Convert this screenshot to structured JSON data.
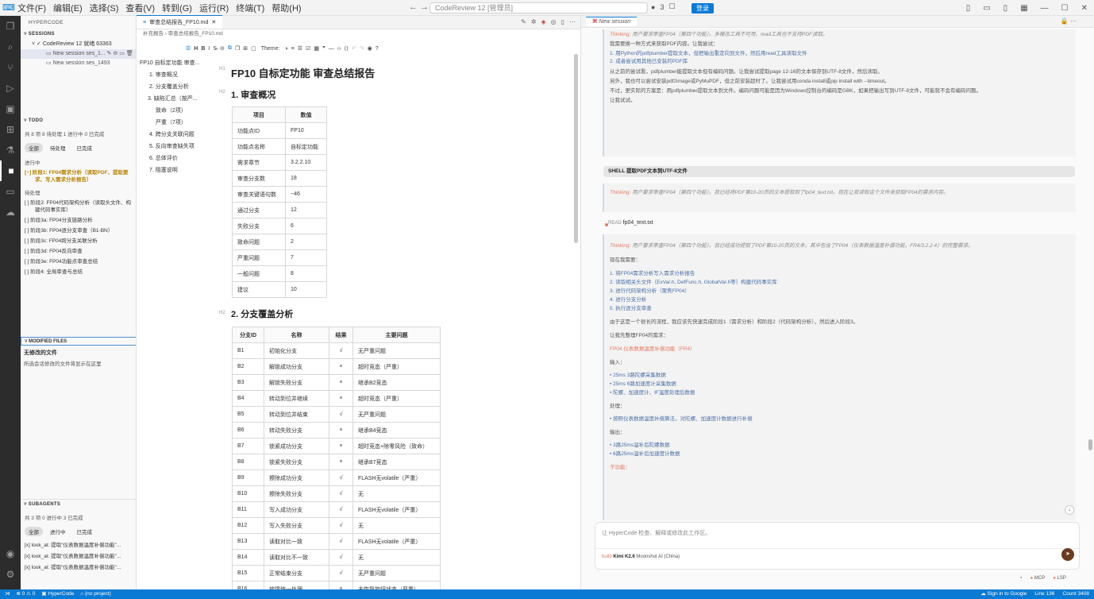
{
  "menu": [
    "文件(F)",
    "编辑(E)",
    "选择(S)",
    "查看(V)",
    "转到(G)",
    "运行(R)",
    "终端(T)",
    "帮助(H)"
  ],
  "command_center": "CodeReview 12 [管理员]",
  "account": {
    "count": "3",
    "login": "登录"
  },
  "sidebar": {
    "title": "HYPERCODE",
    "sessions_h": "SESSIONS",
    "sessions": [
      {
        "label": "CodeReview 12 就绪 63363"
      },
      {
        "label": "New session ses_1..."
      },
      {
        "label": "New session ses_1493"
      }
    ],
    "todo_h": "TODO",
    "todo_meta": "共 8 项  8 待处理  1 进行中  0 已完成",
    "todo_pills": [
      "全部",
      "待处理",
      "已完成"
    ],
    "in_progress_h": "进行中",
    "in_progress": [
      "[~] 阶段1: FP04需求分析（读取PDF、提取要求、写入需求分析报告）"
    ],
    "pending_h": "待处理",
    "pending": [
      "[ ] 阶段2: FP04代码架构分析（读取头文件、构建代码事实库）",
      "[ ] 阶段3a: FP04分支链路分析",
      "[ ] 阶段3b: FP04逐分支审查（B1-BN）",
      "[ ] 阶段3c: FP04跨分支关联分析",
      "[ ] 阶段3d: FP04反向审查",
      "[ ] 阶段3e: FP04功能点审查总结",
      "[ ] 阶段4: 全局审查与总结"
    ],
    "mf_h": "MODIFIED FILES",
    "mf_title": "无修改的文件",
    "mf_desc": "所选会话修改的文件将显示在这里",
    "sa_h": "SUBAGENTS",
    "sa_meta": "共 3 项  0 进行中  3 已完成",
    "sa_pills": [
      "全部",
      "进行中",
      "已完成"
    ],
    "subagents": [
      "[x]  look_at: 提取\"仪表数据温度补偿功能\"...",
      "[x]  look_at: 提取\"仪表数据温度补偿功能\"...",
      "[x]  look_at: 提取\"仪表数据温度补偿功能\"..."
    ]
  },
  "editor": {
    "tab": "审查总结报告_FP10.md",
    "crumb": "补充报告 › 审查总结报告_FP10.md",
    "theme": "Theme:",
    "outline": [
      "FP10 自标定功能 审查...",
      "1. 审查概况",
      "2. 分支覆盖分析",
      "3. 缺陷汇总（按严...",
      "致命（2项）",
      "严重（7项）",
      "4. 跨分支关联问题",
      "5. 反向审查缺失项",
      "6. 总体评价",
      "7. 阻塞说明"
    ],
    "h1": "FP10 自标定功能 审查总结报告",
    "h2a": "1. 审查概况",
    "h2b": "2. 分支覆盖分析",
    "t1_head": [
      "项目",
      "数值"
    ],
    "t1": [
      [
        "功能点ID",
        "FP10"
      ],
      [
        "功能点名称",
        "自标定功能"
      ],
      [
        "需求章节",
        "3.2.2.10"
      ],
      [
        "审查分支数",
        "18"
      ],
      [
        "审查关键语句数",
        "~46"
      ],
      [
        "通过分支",
        "12"
      ],
      [
        "失败分支",
        "6"
      ],
      [
        "致命问题",
        "2"
      ],
      [
        "严重问题",
        "7"
      ],
      [
        "一般问题",
        "8"
      ],
      [
        "建议",
        "10"
      ]
    ],
    "t2_head": [
      "分支ID",
      "名称",
      "结果",
      "主要问题"
    ],
    "t2": [
      [
        "B1",
        "初始化分支",
        "√",
        "无严重问题"
      ],
      [
        "B2",
        "解锁成功分支",
        "×",
        "超时竞态（严重）"
      ],
      [
        "B3",
        "解锁失败分支",
        "×",
        "继承B2竞态"
      ],
      [
        "B4",
        "转动到位并继续",
        "×",
        "超时竞态（严重）"
      ],
      [
        "B5",
        "转动到位并结束",
        "√",
        "无严重问题"
      ],
      [
        "B6",
        "转动失败分支",
        "×",
        "继承B4竞态"
      ],
      [
        "B7",
        "锁紧成功分支",
        "×",
        "超时竞态+除零风险（致命）"
      ],
      [
        "B8",
        "锁紧失败分支",
        "×",
        "继承B7竞态"
      ],
      [
        "B9",
        "擦除成功分支",
        "√",
        "FLASH无volatile（严重）"
      ],
      [
        "B10",
        "擦除失败分支",
        "√",
        "无"
      ],
      [
        "B11",
        "写入成功分支",
        "√",
        "FLASH无volatile（严重）"
      ],
      [
        "B12",
        "写入失败分支",
        "√",
        "无"
      ],
      [
        "B13",
        "读取对比一致",
        "√",
        "FLASH无volatile（严重）"
      ],
      [
        "B14",
        "读取对比不一致",
        "√",
        "无"
      ],
      [
        "B15",
        "正常结束分支",
        "√",
        "无严重问题"
      ],
      [
        "B16",
        "故障统一处理",
        "×",
        "未恢复旋钮状态（严重）"
      ]
    ]
  },
  "agent": {
    "tab": "New session",
    "c1_think": "用户要求审查FP04（第四个功能）。多模态工具不可用，read工具也不支持PDF读取。",
    "c1_p1": "我需要换一种方式来获取PDF内容。让我尝试：",
    "c1_list": [
      "1. 用Python的pdfplumber提取文本，但把输出重定向到文件，然后用read工具读取文件",
      "2. 或者尝试用其他已安装的PDF库"
    ],
    "c1_p2": "从之前的尝试看，pdfplumber能提取文本但有编码问题。让我尝试提取page 12-16的文本保存到UTF-8文件，然后读取。",
    "c1_p3": "另外，我也可以尝试安装pdf2image或PyMuPDF，但之前安装超时了。让我尝试用conda install或pip install with --timeout。",
    "c1_p4": "不过，更实际的方案是：用pdfplumber提取文本到文件。编码问题可能是因为Windows控制台的编码是GBK，如果把输出写到UTF-8文件，可能就不会有编码问题。",
    "c1_p5": "让我试试。",
    "shell": "SHELL  提取PDF文本到UTF-8文件",
    "c2_think": "用户要求审查FP04（第四个功能）。我已经将PDF第10-20页的文本提取到了fp04_text.txt。现在让我读取这个文件来获取FP04的需求内容。",
    "read_k": "READ",
    "read_v": "fp04_text.txt",
    "c3_think": "用户要求审查FP04（第四个功能）。我已经成功提取了PDF第10-20页的文本，其中包含了FP04（仪表数据温度补偿功能，FR4/3.2.2.4）的完整需求。",
    "c3_p1": "现在我需要：",
    "c3_list": [
      "1. 将FP04需求分析写入需求分析报告",
      "2. 读取相关头文件（ExVar.h, DefFunc.h, GlobalVar.h等）构建代码事实库",
      "3. 进行代码架构分析（聚焦FP04）",
      "4. 进行分支分析",
      "5. 执行逐分支审查"
    ],
    "c3_p2": "由于这是一个很长的流程，我应该先快速完成阶段1（需求分析）和阶段2（代码架构分析），然后进入阶段3。",
    "c3_p3": "让我先整理FP04的需求：",
    "c3_h": "FP04 仪表数据温度补偿功能（FR4）",
    "c3_in": "输入：",
    "c3_inl": [
      "• 25ms 3路陀螺采集数据",
      "• 25ms 6路加速度计采集数据",
      "• 陀螺、加速度计、IF温度处理后数据"
    ],
    "c3_proc": "处理：",
    "c3_procl": [
      "• 按照仪表数据温度补偿算法，对陀螺、加速度计数据进行补偿"
    ],
    "c3_out": "输出：",
    "c3_outl": [
      "• 3路25ms温补后陀螺数据",
      "• 6路25ms温补后加速度计数据"
    ],
    "c3_sub": "子功能：",
    "compose_ph": "让 HyperCode 检查、解释或修改此工作区。",
    "model_pre": "build",
    "model": "Kimi K2.6",
    "model_post": "Moonshot AI (China)",
    "mcp": "MCP",
    "lsp": "LSP"
  },
  "status": {
    "errors": "⊗ 0 ⚠ 0",
    "app": "HyperCode",
    "proj": "{no project}",
    "signin": "Sign in to Google",
    "line": "Line 136",
    "count": "Count 3408"
  }
}
